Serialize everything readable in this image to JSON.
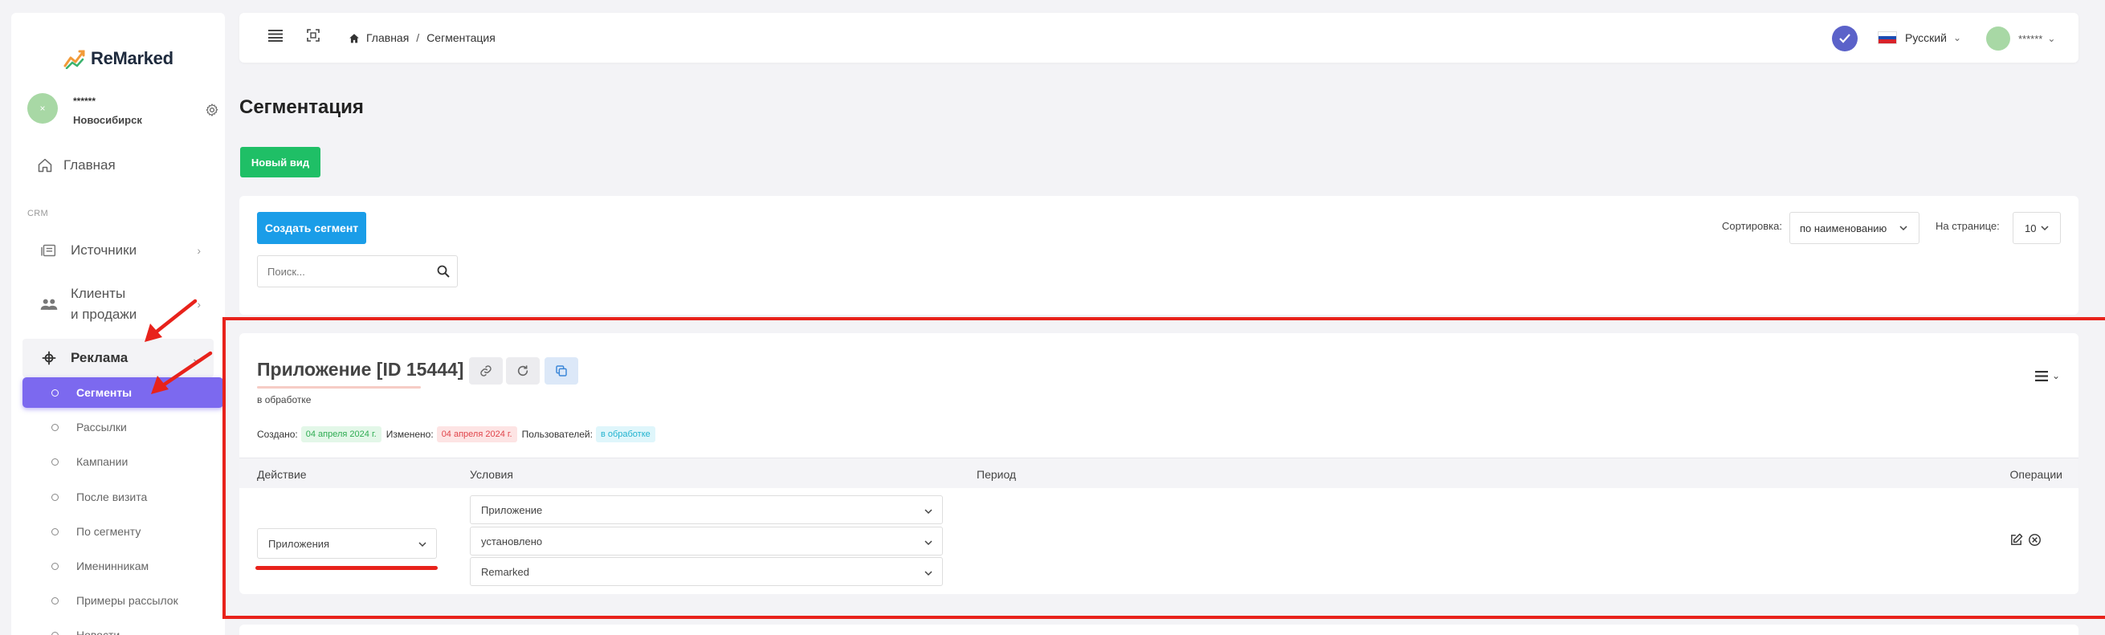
{
  "brand": {
    "name": "ReMarked"
  },
  "user": {
    "name": "******",
    "city": "Новосибирск",
    "avatar_initial": "×"
  },
  "sidebar": {
    "home": "Главная",
    "section_label": "CRM",
    "items": [
      {
        "label": "Источники"
      },
      {
        "label_line1": "Клиенты",
        "label_line2": "и продажи"
      },
      {
        "label": "Реклама"
      }
    ],
    "subitems": [
      {
        "label": "Сегменты"
      },
      {
        "label": "Рассылки"
      },
      {
        "label": "Кампании"
      },
      {
        "label": "После визита"
      },
      {
        "label": "По сегменту"
      },
      {
        "label": "Именинникам"
      },
      {
        "label": "Примеры рассылок"
      },
      {
        "label": "Новости"
      }
    ]
  },
  "topbar": {
    "breadcrumb": [
      "Главная",
      "Сегментация"
    ],
    "language": "Русский",
    "user_name": "******"
  },
  "page": {
    "title": "Сегментация",
    "new_view_button": "Новый вид"
  },
  "filter": {
    "create_button": "Создать сегмент",
    "search_placeholder": "Поиск...",
    "sort_label": "Сортировка:",
    "sort_value": "по наименованию",
    "per_page_label": "На странице:",
    "per_page_value": "10"
  },
  "segment": {
    "title": "Приложение [ID 15444]",
    "status": "в обработке",
    "created_label": "Создано:",
    "created_date": "04 апреля 2024 г.",
    "modified_label": "Изменено:",
    "modified_date": "04 апреля 2024 г.",
    "users_label": "Пользователей:",
    "users_value": "в обработке",
    "columns": {
      "action": "Действие",
      "conditions": "Условия",
      "period": "Период",
      "operations": "Операции"
    },
    "row": {
      "action": "Приложения",
      "conditions": [
        "Приложение",
        "установлено",
        "Remarked"
      ]
    }
  },
  "colors": {
    "accent_purple": "#7c69ef",
    "primary_blue": "#1a9de8",
    "success_green": "#1fbf66",
    "highlight_red": "#e8221b"
  }
}
